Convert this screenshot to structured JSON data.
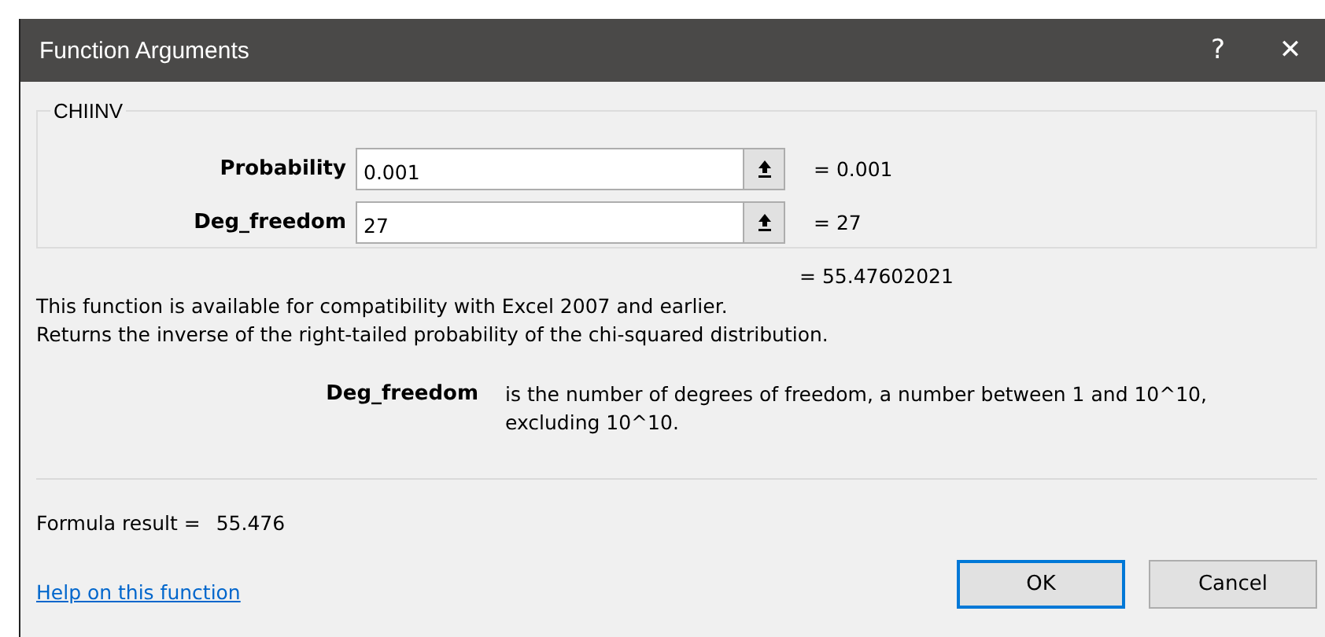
{
  "window": {
    "title": "Function Arguments",
    "help_glyph": "?",
    "close_glyph": "✕"
  },
  "function_group": {
    "name": "CHIINV",
    "arguments": [
      {
        "label": "Probability",
        "value": "0.001",
        "result": "= 0.001"
      },
      {
        "label": "Deg_freedom",
        "value": "27",
        "result": "= 27"
      }
    ]
  },
  "function_result": "= 55.47602021",
  "description": [
    "This function is available for compatibility with Excel 2007 and earlier.",
    "Returns the inverse of the right-tailed probability of the chi-squared distribution."
  ],
  "argument_help": {
    "name": "Deg_freedom",
    "text": "is the number of degrees of freedom, a number between 1 and 10^10, excluding 10^10."
  },
  "formula_result": {
    "label": "Formula result =",
    "value": "55.476"
  },
  "help_link": "Help on this function",
  "buttons": [
    {
      "label": "OK",
      "selected": true
    },
    {
      "label": "Cancel",
      "selected": false
    }
  ]
}
